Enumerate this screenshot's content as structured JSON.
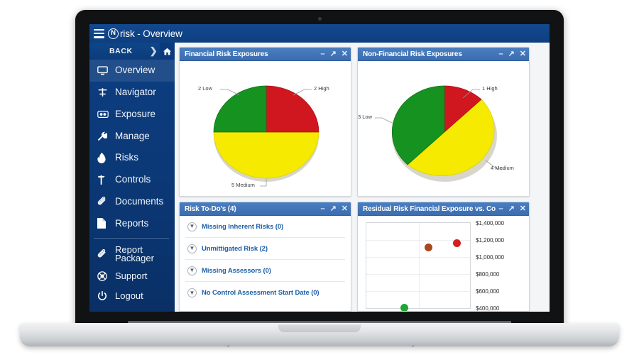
{
  "app": {
    "title": "risk - Overview",
    "brand_letter": "N",
    "hamburger_icon": "hamburger-menu-icon",
    "topbar_color": "#0e3f80"
  },
  "sidebar": {
    "back_label": "BACK",
    "back_chevron_icon": "chevron-right-icon",
    "home_icon": "home-icon",
    "items": [
      {
        "label": "Overview",
        "icon": "monitor-icon",
        "active": true
      },
      {
        "label": "Navigator",
        "icon": "navigator-icon",
        "active": false
      },
      {
        "label": "Exposure",
        "icon": "exposure-icon",
        "active": false
      },
      {
        "label": "Manage",
        "icon": "wrench-icon",
        "active": false
      },
      {
        "label": "Risks",
        "icon": "flame-icon",
        "active": false
      },
      {
        "label": "Controls",
        "icon": "controls-icon",
        "active": false
      },
      {
        "label": "Documents",
        "icon": "paperclip-icon",
        "active": false
      },
      {
        "label": "Reports",
        "icon": "document-icon",
        "active": false
      }
    ],
    "footer_items": [
      {
        "label": "Report\nPackager",
        "icon": "paperclip-icon",
        "two_line": true
      },
      {
        "label": "Support",
        "icon": "lifebuoy-icon",
        "two_line": false
      },
      {
        "label": "Logout",
        "icon": "power-icon",
        "two_line": false
      }
    ]
  },
  "panel_controls": {
    "minimize": "–",
    "expand": "↗",
    "close": "✕",
    "minimize_name": "minimize-icon",
    "expand_name": "expand-icon",
    "close_name": "close-icon"
  },
  "panels": {
    "financial": {
      "title": "Financial Risk Exposures"
    },
    "nonfinancial": {
      "title": "Non-Financial Risk Exposures"
    },
    "todo": {
      "title": "Risk To-Do's (4)"
    },
    "scatter": {
      "title": "Residual Risk Financial Exposure vs. Co"
    }
  },
  "todo": {
    "items": [
      {
        "label": "Missing Inherent Risks (0)",
        "chevron": "chevron-down-icon"
      },
      {
        "label": "Unmittigated Risk (2)",
        "chevron": "chevron-down-icon"
      },
      {
        "label": "Missing Assessors (0)",
        "chevron": "chevron-down-icon"
      },
      {
        "label": "No Control Assessment Start Date (0)",
        "chevron": "chevron-down-icon"
      }
    ]
  },
  "colors": {
    "high": "#d0161f",
    "medium": "#f5ea00",
    "low": "#159220",
    "brown": "#a8481c",
    "green_dot": "#1ea832",
    "red_dot": "#d41f1f"
  },
  "chart_data": [
    {
      "type": "pie",
      "title": "Financial Risk Exposures",
      "categories": [
        "High",
        "Medium",
        "Low"
      ],
      "values": [
        2,
        5,
        2
      ],
      "labels": [
        "2 High",
        "5 Medium",
        "2 Low"
      ],
      "colors": [
        "#d0161f",
        "#f5ea00",
        "#159220"
      ],
      "total": 9,
      "start_angle_deg": 0,
      "legend": "none",
      "note": "Red quadrant top-right (0-90deg), yellow bottom half (90-270deg), green top-left (270-360deg)"
    },
    {
      "type": "pie",
      "title": "Non-Financial Risk Exposures",
      "categories": [
        "High",
        "Medium",
        "Low"
      ],
      "values": [
        1,
        4,
        3
      ],
      "labels": [
        "1 High",
        "4 Medium",
        "3 Low"
      ],
      "colors": [
        "#d0161f",
        "#f5ea00",
        "#159220"
      ],
      "total": 8,
      "start_angle_deg": 0,
      "legend": "none",
      "note": "Red 0-45deg, yellow 45-225deg, green 225-360deg"
    },
    {
      "type": "scatter",
      "title": "Residual Risk Financial Exposure vs. Co",
      "xlabel": "",
      "ylabel": "",
      "ytick_labels": [
        "$1,400,000",
        "$1,200,000",
        "$1,000,000",
        "$800,000",
        "$600,000",
        "$400,000"
      ],
      "ytick_values": [
        1400000,
        1200000,
        1000000,
        800000,
        600000,
        400000
      ],
      "ylim": [
        400000,
        1400000
      ],
      "grid": true,
      "legend": "none",
      "points": [
        {
          "x": 0.6,
          "y": 1100000,
          "color": "#a8481c",
          "label": "",
          "size": 11
        },
        {
          "x": 0.88,
          "y": 1150000,
          "color": "#d41f1f",
          "label": "",
          "size": 11
        },
        {
          "x": 0.36,
          "y": 420000,
          "color": "#1ea832",
          "label": "",
          "size": 11
        }
      ]
    }
  ]
}
